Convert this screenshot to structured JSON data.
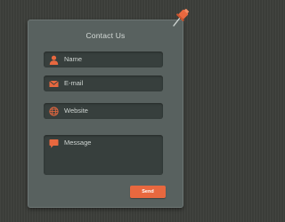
{
  "form": {
    "title": "Contact Us",
    "fields": [
      {
        "label": "Name",
        "icon": "user-icon"
      },
      {
        "label": "E-mail",
        "icon": "envelope-icon"
      },
      {
        "label": "Website",
        "icon": "globe-icon"
      },
      {
        "label": "Message",
        "icon": "speech-bubble-icon"
      }
    ],
    "send_label": "Send"
  },
  "colors": {
    "background": "#3b3d39",
    "card": "#58615f",
    "field": "#373f3d",
    "accent": "#e8683f",
    "text": "#d6dcd9"
  }
}
